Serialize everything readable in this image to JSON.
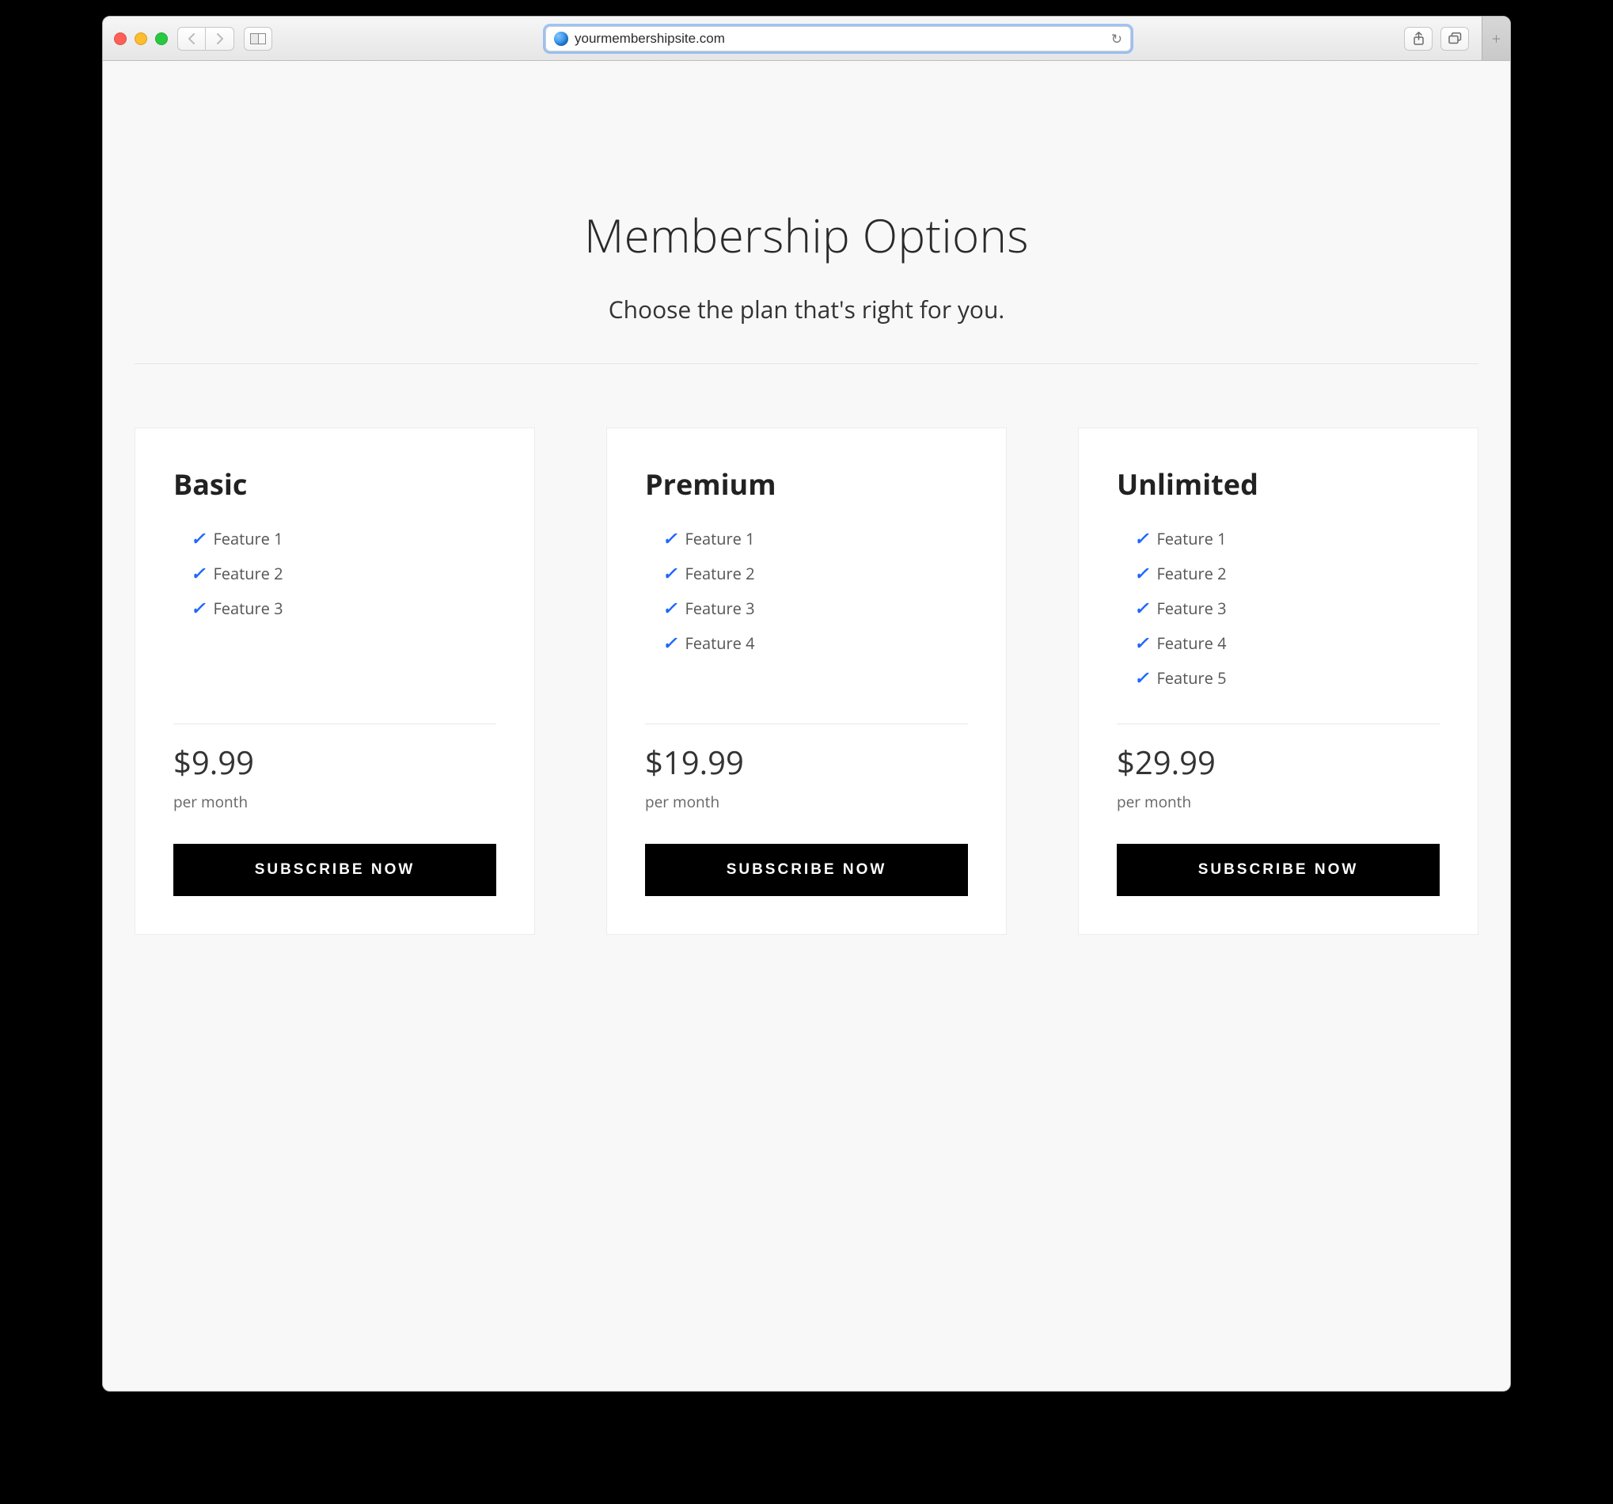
{
  "browser": {
    "url": "yourmembershipsite.com"
  },
  "page": {
    "title": "Membership Options",
    "subtitle": "Choose the plan that's right for you."
  },
  "plans": [
    {
      "name": "Basic",
      "features": [
        "Feature 1",
        "Feature 2",
        "Feature 3"
      ],
      "price": "$9.99",
      "period": "per month",
      "cta": "SUBSCRIBE NOW"
    },
    {
      "name": "Premium",
      "features": [
        "Feature 1",
        "Feature 2",
        "Feature 3",
        "Feature 4"
      ],
      "price": "$19.99",
      "period": "per month",
      "cta": "SUBSCRIBE NOW"
    },
    {
      "name": "Unlimited",
      "features": [
        "Feature 1",
        "Feature 2",
        "Feature 3",
        "Feature 4",
        "Feature 5"
      ],
      "price": "$29.99",
      "period": "per month",
      "cta": "SUBSCRIBE NOW"
    }
  ]
}
